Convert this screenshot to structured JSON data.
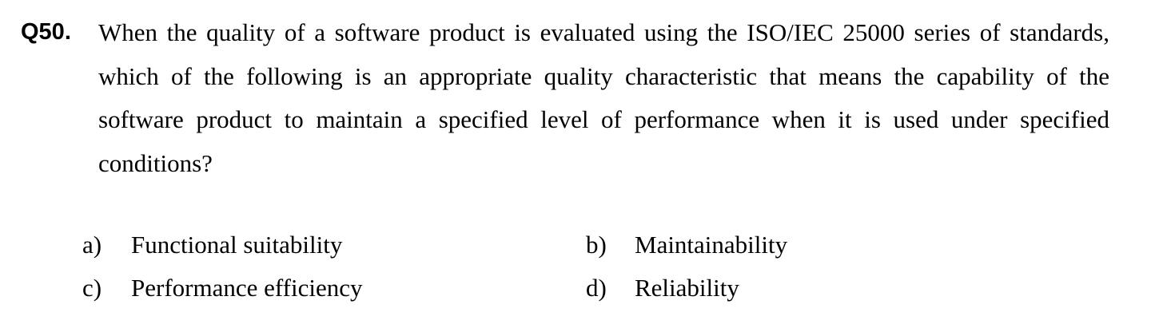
{
  "question": {
    "number": "Q50.",
    "text": "When the quality of a software product is evaluated using the ISO/IEC 25000 series of standards, which of the following is an appropriate quality characteristic that means the capability of the software product to maintain a specified level of performance when it is used under specified conditions?"
  },
  "options": [
    {
      "letter": "a)",
      "text": "Functional suitability"
    },
    {
      "letter": "b)",
      "text": "Maintainability"
    },
    {
      "letter": "c)",
      "text": "Performance efficiency"
    },
    {
      "letter": "d)",
      "text": "Reliability"
    }
  ]
}
